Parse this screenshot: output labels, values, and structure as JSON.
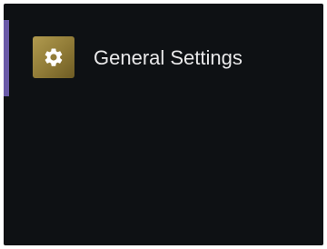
{
  "menu": {
    "items": [
      {
        "label": "General Settings",
        "icon": "gear-icon",
        "active": true
      }
    ]
  },
  "colors": {
    "panel_background": "#0e1114",
    "active_indicator": "#6a5aa8",
    "icon_tile": "#9c8640",
    "label_text": "#e9e9ea"
  }
}
